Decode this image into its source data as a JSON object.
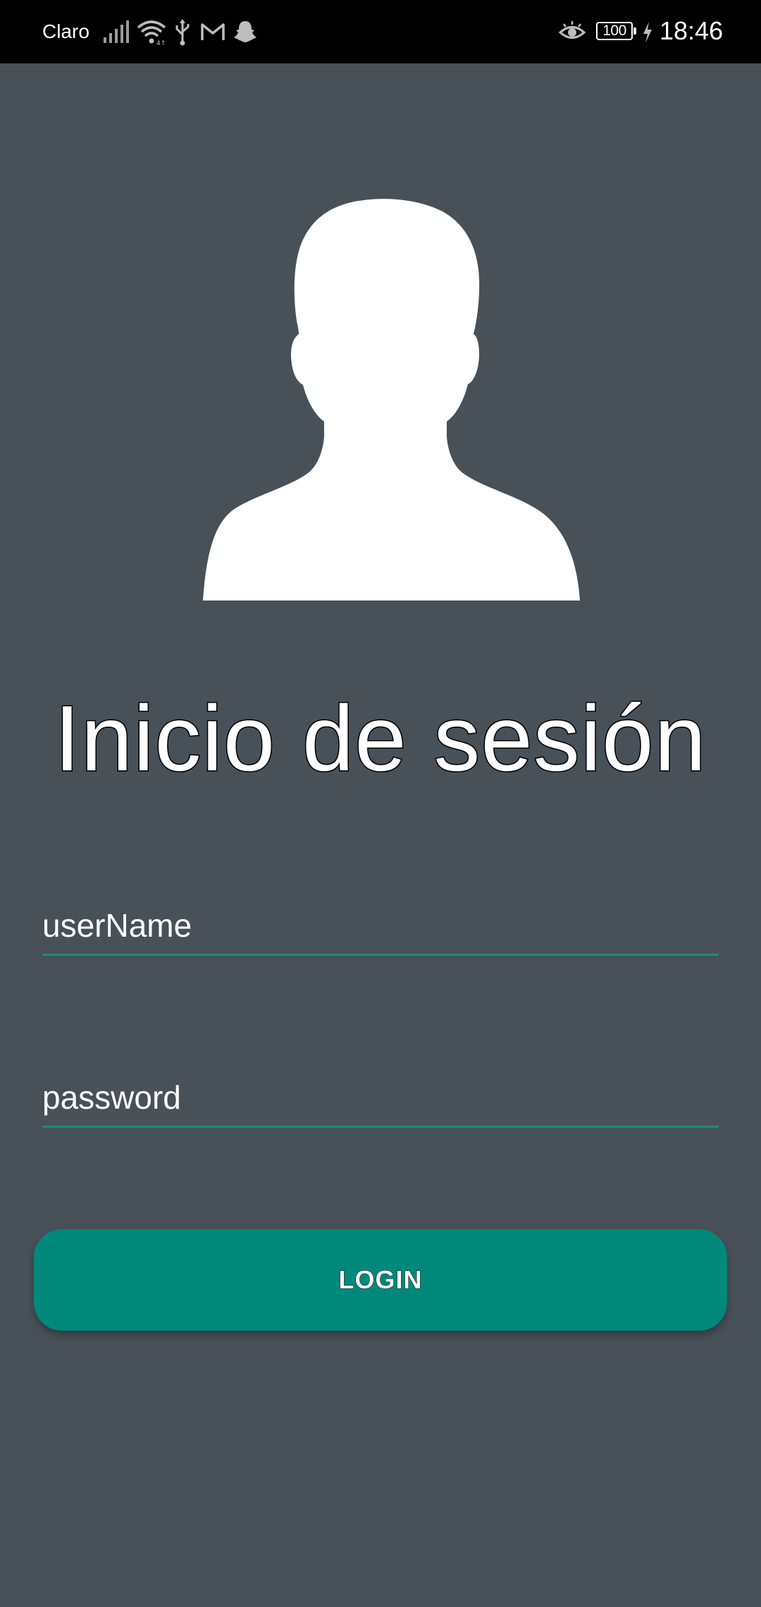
{
  "status_bar": {
    "carrier": "Claro",
    "battery_level": "100",
    "time": "18:46",
    "icons": [
      "signal-icon",
      "wifi-icon",
      "usb-icon",
      "gmail-icon",
      "snapchat-icon",
      "eye-icon",
      "battery-icon",
      "charging-bolt-icon"
    ]
  },
  "login": {
    "avatar_icon": "user-silhouette-icon",
    "title": "Inicio de sesión",
    "username_placeholder": "userName",
    "password_placeholder": "password",
    "login_label": "LOGIN"
  },
  "colors": {
    "background": "#485058",
    "accent": "#00897b",
    "status_bar": "#000000"
  }
}
